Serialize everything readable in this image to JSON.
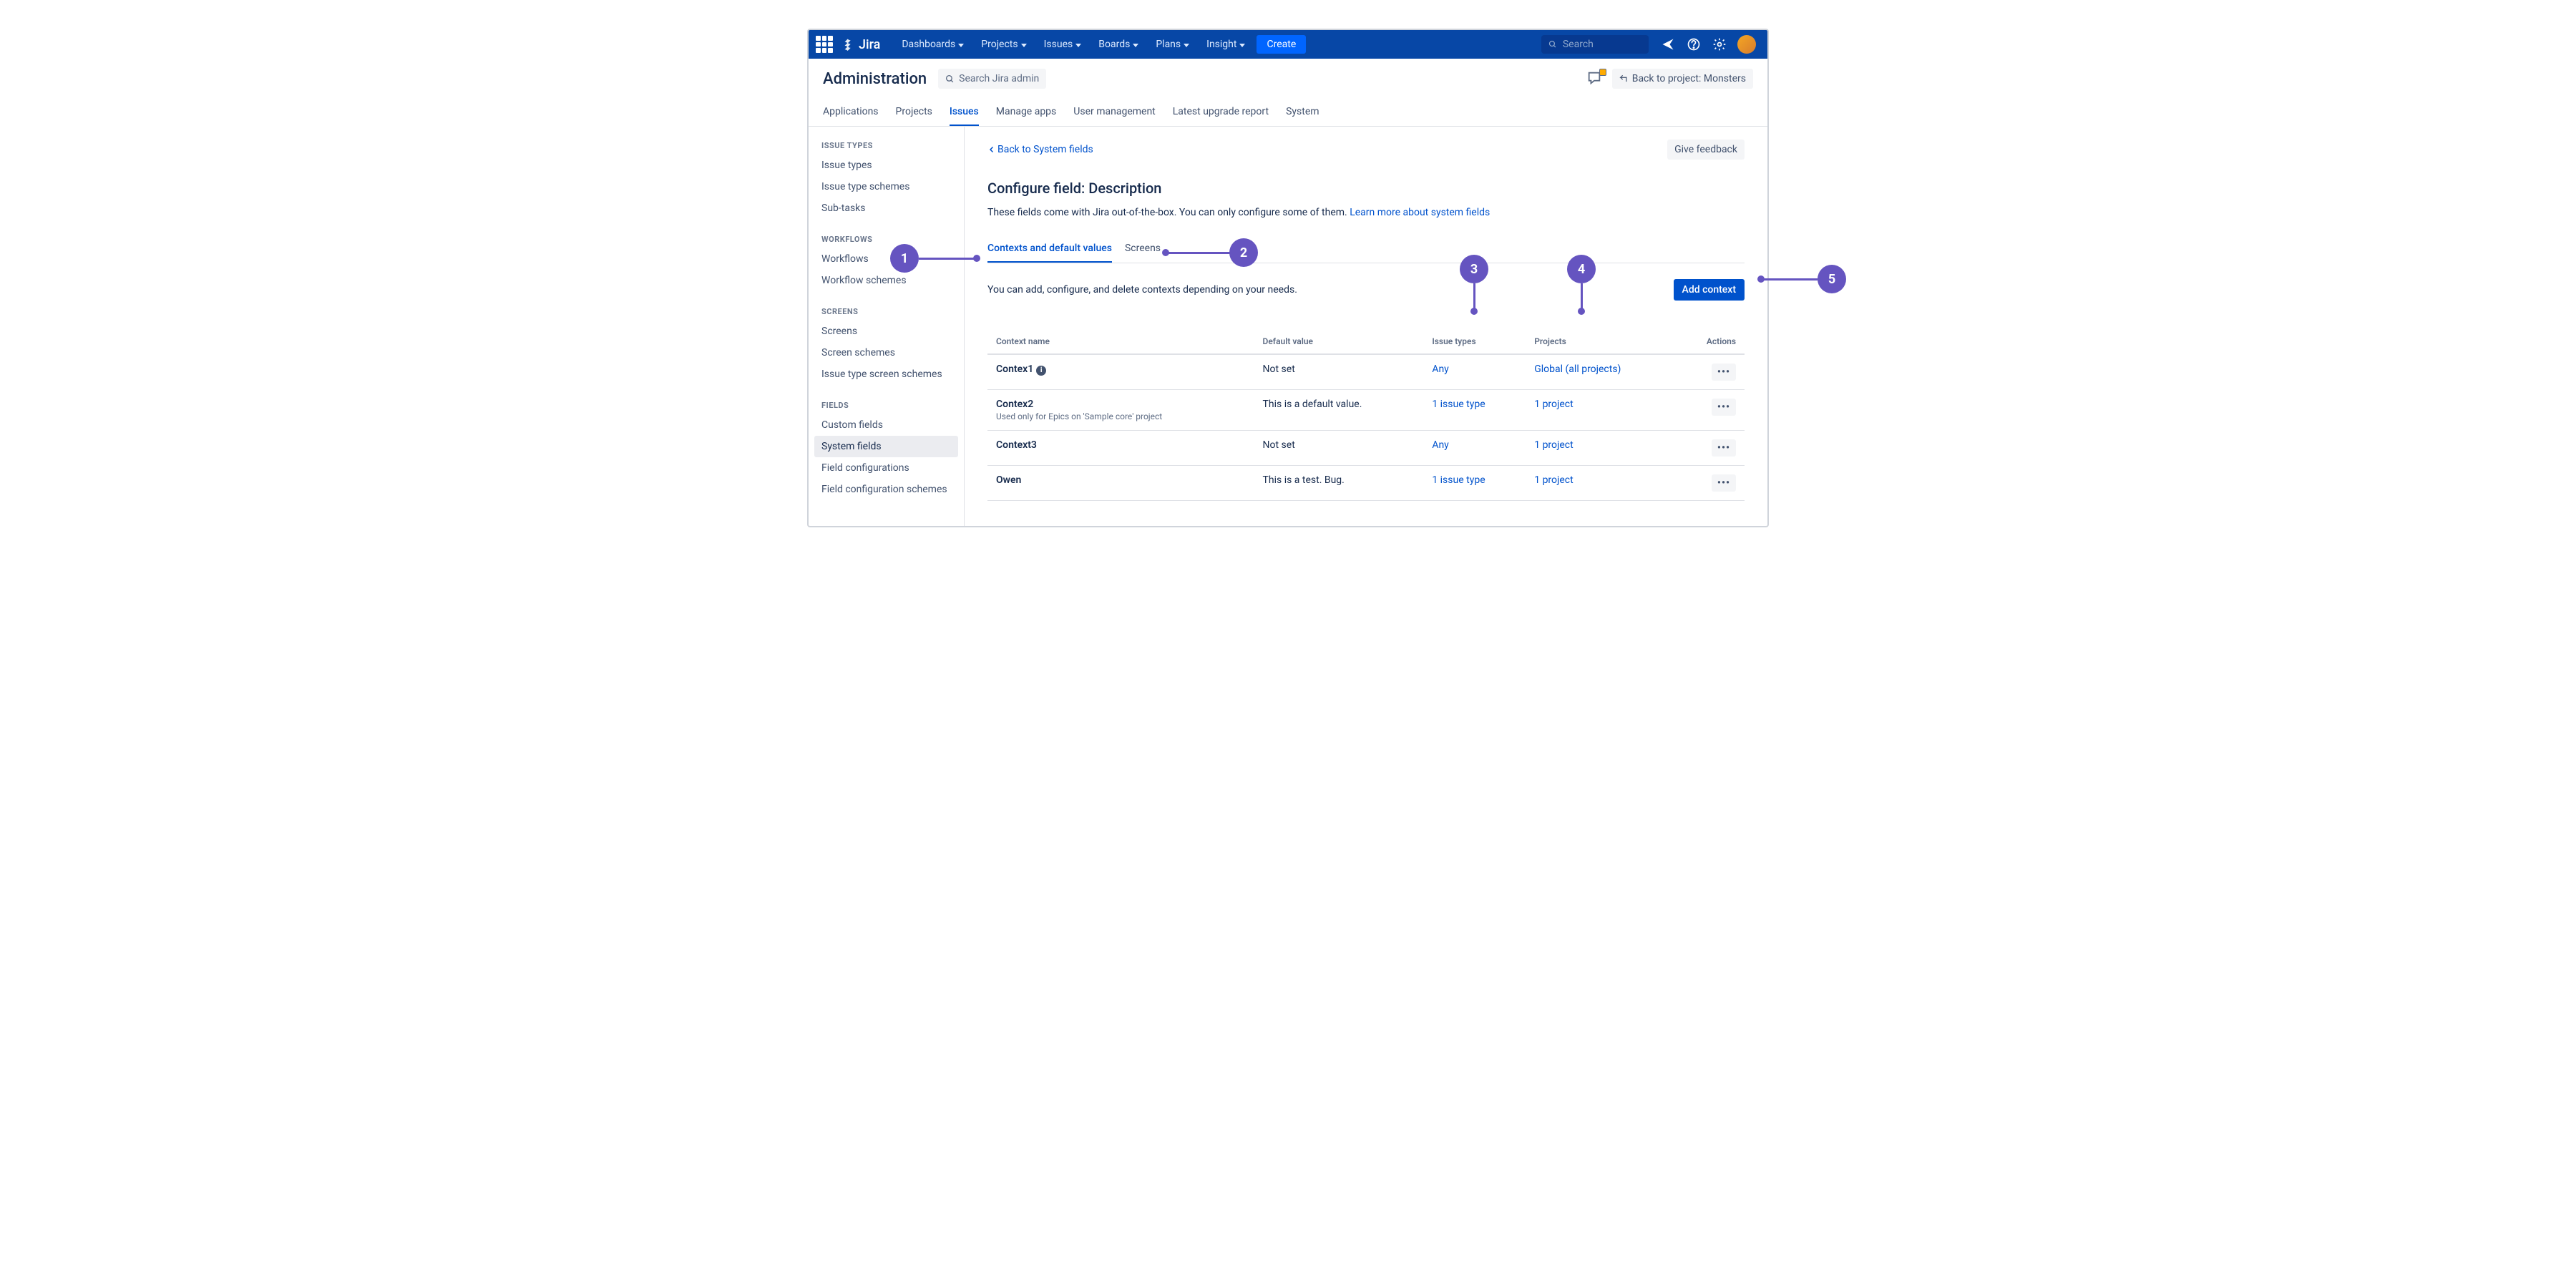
{
  "brand": "Jira",
  "nav": {
    "items": [
      "Dashboards",
      "Projects",
      "Issues",
      "Boards",
      "Plans",
      "Insight"
    ],
    "create": "Create",
    "search_placeholder": "Search"
  },
  "admin": {
    "title": "Administration",
    "search_placeholder": "Search Jira admin",
    "back_to_project": "Back to project: Monsters"
  },
  "tabs": [
    "Applications",
    "Projects",
    "Issues",
    "Manage apps",
    "User management",
    "Latest upgrade report",
    "System"
  ],
  "active_tab": "Issues",
  "sidebar": {
    "groups": [
      {
        "title": "ISSUE TYPES",
        "items": [
          "Issue types",
          "Issue type schemes",
          "Sub-tasks"
        ]
      },
      {
        "title": "WORKFLOWS",
        "items": [
          "Workflows",
          "Workflow schemes"
        ]
      },
      {
        "title": "SCREENS",
        "items": [
          "Screens",
          "Screen schemes",
          "Issue type screen schemes"
        ]
      },
      {
        "title": "FIELDS",
        "items": [
          "Custom fields",
          "System fields",
          "Field configurations",
          "Field configuration schemes"
        ]
      }
    ],
    "active": "System fields"
  },
  "content": {
    "back_link": "Back to System fields",
    "feedback_btn": "Give feedback",
    "heading": "Configure field: Description",
    "desc": "These fields come with Jira out-of-the-box. You can only configure some of them. ",
    "learn_more": "Learn more about system fields",
    "inner_tabs": [
      "Contexts and default values",
      "Screens"
    ],
    "inner_active": "Contexts and default values",
    "inner_desc": "You can add, configure, and delete contexts depending on your needs.",
    "add_context": "Add context",
    "table": {
      "headers": [
        "Context name",
        "Default value",
        "Issue types",
        "Projects",
        "Actions"
      ],
      "rows": [
        {
          "name": "Contex1",
          "info": true,
          "sub": "",
          "default": "Not set",
          "issue_types": "Any",
          "projects": "Global (all projects)"
        },
        {
          "name": "Contex2",
          "info": false,
          "sub": "Used only for Epics on 'Sample core' project",
          "default": "This is a default value.",
          "issue_types": "1 issue type",
          "projects": "1 project"
        },
        {
          "name": "Context3",
          "info": false,
          "sub": "",
          "default": "Not set",
          "issue_types": "Any",
          "projects": "1 project"
        },
        {
          "name": "Owen",
          "info": false,
          "sub": "",
          "default": "This is a test. Bug.",
          "issue_types": "1 issue type",
          "projects": "1 project"
        }
      ]
    }
  },
  "callouts": [
    "1",
    "2",
    "3",
    "4",
    "5"
  ]
}
